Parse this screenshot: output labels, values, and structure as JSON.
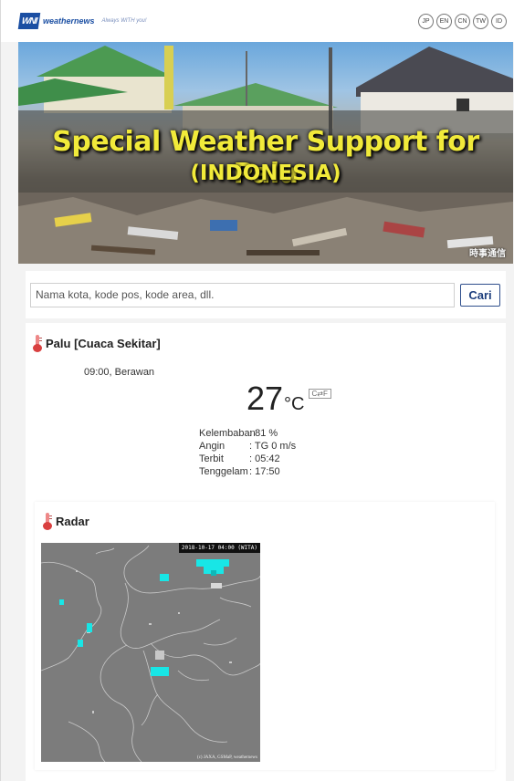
{
  "header": {
    "logo_mark": "WNI",
    "logo_text": "weathernews",
    "logo_tagline": "Always WITH you!",
    "languages": [
      "JP",
      "EN",
      "CN",
      "TW",
      "ID"
    ]
  },
  "hero": {
    "title": "Special Weather Support for Palu",
    "subtitle": "(INDONESIA)",
    "credit": "時事通信"
  },
  "search": {
    "placeholder": "Nama kota, kode pos, kode area, dll.",
    "button_label": "Cari"
  },
  "weather": {
    "location_title": "Palu [Cuaca Sekitar]",
    "time_condition": "09:00, Berawan",
    "temperature": "27",
    "temperature_unit": "°C",
    "unit_toggle": "C⇄F",
    "details": [
      {
        "label": "Kelembaban",
        "value": ": 81 %"
      },
      {
        "label": "Angin",
        "value": ": TG 0 m/s"
      },
      {
        "label": "Terbit",
        "value": ": 05:42"
      },
      {
        "label": "Tenggelam",
        "value": ": 17:50"
      }
    ]
  },
  "radar": {
    "title": "Radar",
    "timestamp": "2018-10-17 04:00 (WITA)",
    "copyright": "(c) JAXA, GSMaP, weathernews"
  },
  "colors": {
    "brand_blue": "#1b4fa3",
    "hero_text": "#f1ea3a",
    "radar_echo": "#18e6e6",
    "radar_background": "#7c7c7c"
  }
}
